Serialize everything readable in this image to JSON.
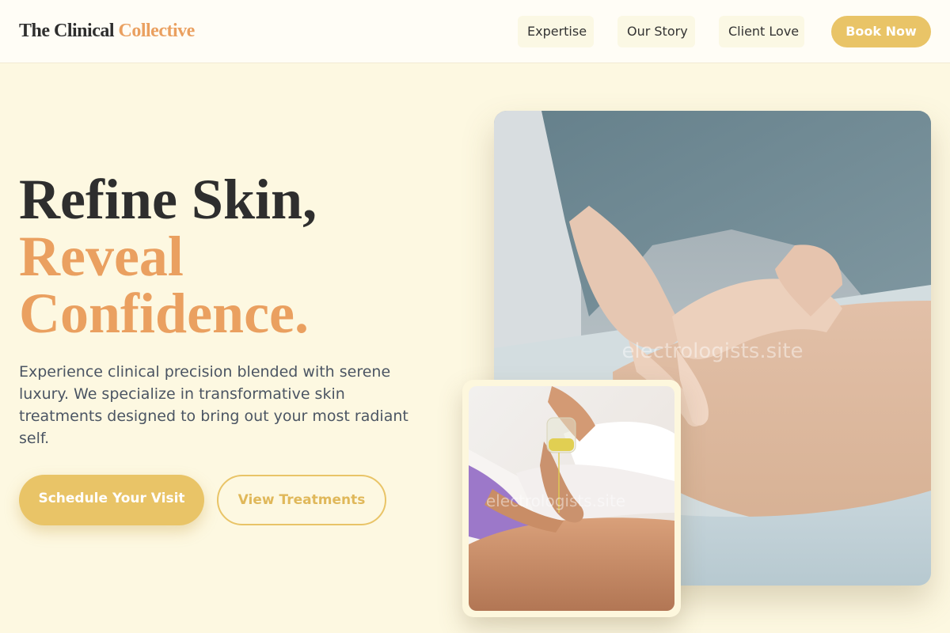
{
  "header": {
    "brand_main": "The Clinical",
    "brand_accent": "Collective",
    "nav": [
      "Expertise",
      "Our Story",
      "Client Love"
    ],
    "book_label": "Book Now"
  },
  "hero": {
    "headline_line1": "Refine Skin,",
    "headline_line2": "Reveal",
    "headline_line3": "Confidence.",
    "description": "Experience clinical precision blended with serene luxury. We specialize in transformative skin treatments designed to bring out your most radiant self.",
    "primary_cta": "Schedule Your Visit",
    "secondary_cta": "View Treatments"
  },
  "images": {
    "watermark": "electrologists.site"
  },
  "colors": {
    "background": "#fdf8e1",
    "accent_orange": "#eaa060",
    "accent_gold": "#e9c467",
    "text_dark": "#2e2e2e",
    "text_body": "#4b5563"
  }
}
